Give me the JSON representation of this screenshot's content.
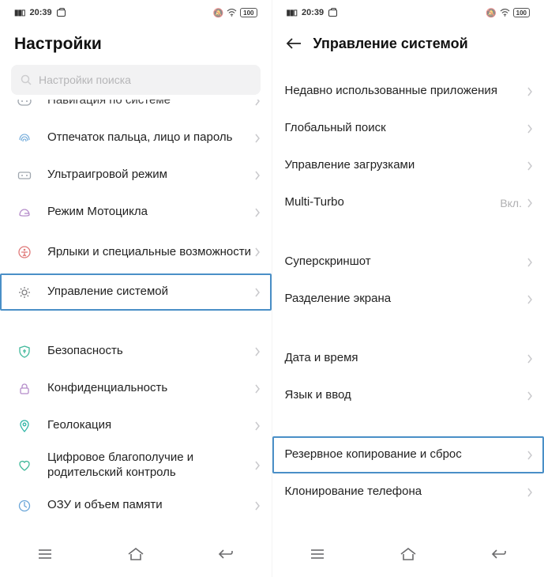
{
  "status": {
    "time": "20:39",
    "battery": "100"
  },
  "left": {
    "title": "Настройки",
    "search_placeholder": "Настройки поиска",
    "items": [
      {
        "label": "Навигация по системе"
      },
      {
        "label": "Отпечаток пальца, лицо и пароль"
      },
      {
        "label": "Ультраигровой режим"
      },
      {
        "label": "Режим Мотоцикла"
      },
      {
        "label": "Ярлыки и специальные возможности"
      },
      {
        "label": "Управление системой"
      },
      {
        "label": "Безопасность"
      },
      {
        "label": "Конфиденциальность"
      },
      {
        "label": "Геолокация"
      },
      {
        "label": "Цифровое благополучие и родительский контроль"
      },
      {
        "label": "ОЗУ и объем памяти"
      }
    ]
  },
  "right": {
    "title": "Управление системой",
    "rows": [
      {
        "label": "Недавно использованные приложения"
      },
      {
        "label": "Глобальный поиск"
      },
      {
        "label": "Управление загрузками"
      },
      {
        "label": "Multi-Turbo",
        "value": "Вкл."
      },
      {
        "label": "Суперскриншот"
      },
      {
        "label": "Разделение экрана"
      },
      {
        "label": "Дата и время"
      },
      {
        "label": "Язык и ввод"
      },
      {
        "label": "Резервное копирование и сброс"
      },
      {
        "label": "Клонирование телефона"
      }
    ]
  }
}
